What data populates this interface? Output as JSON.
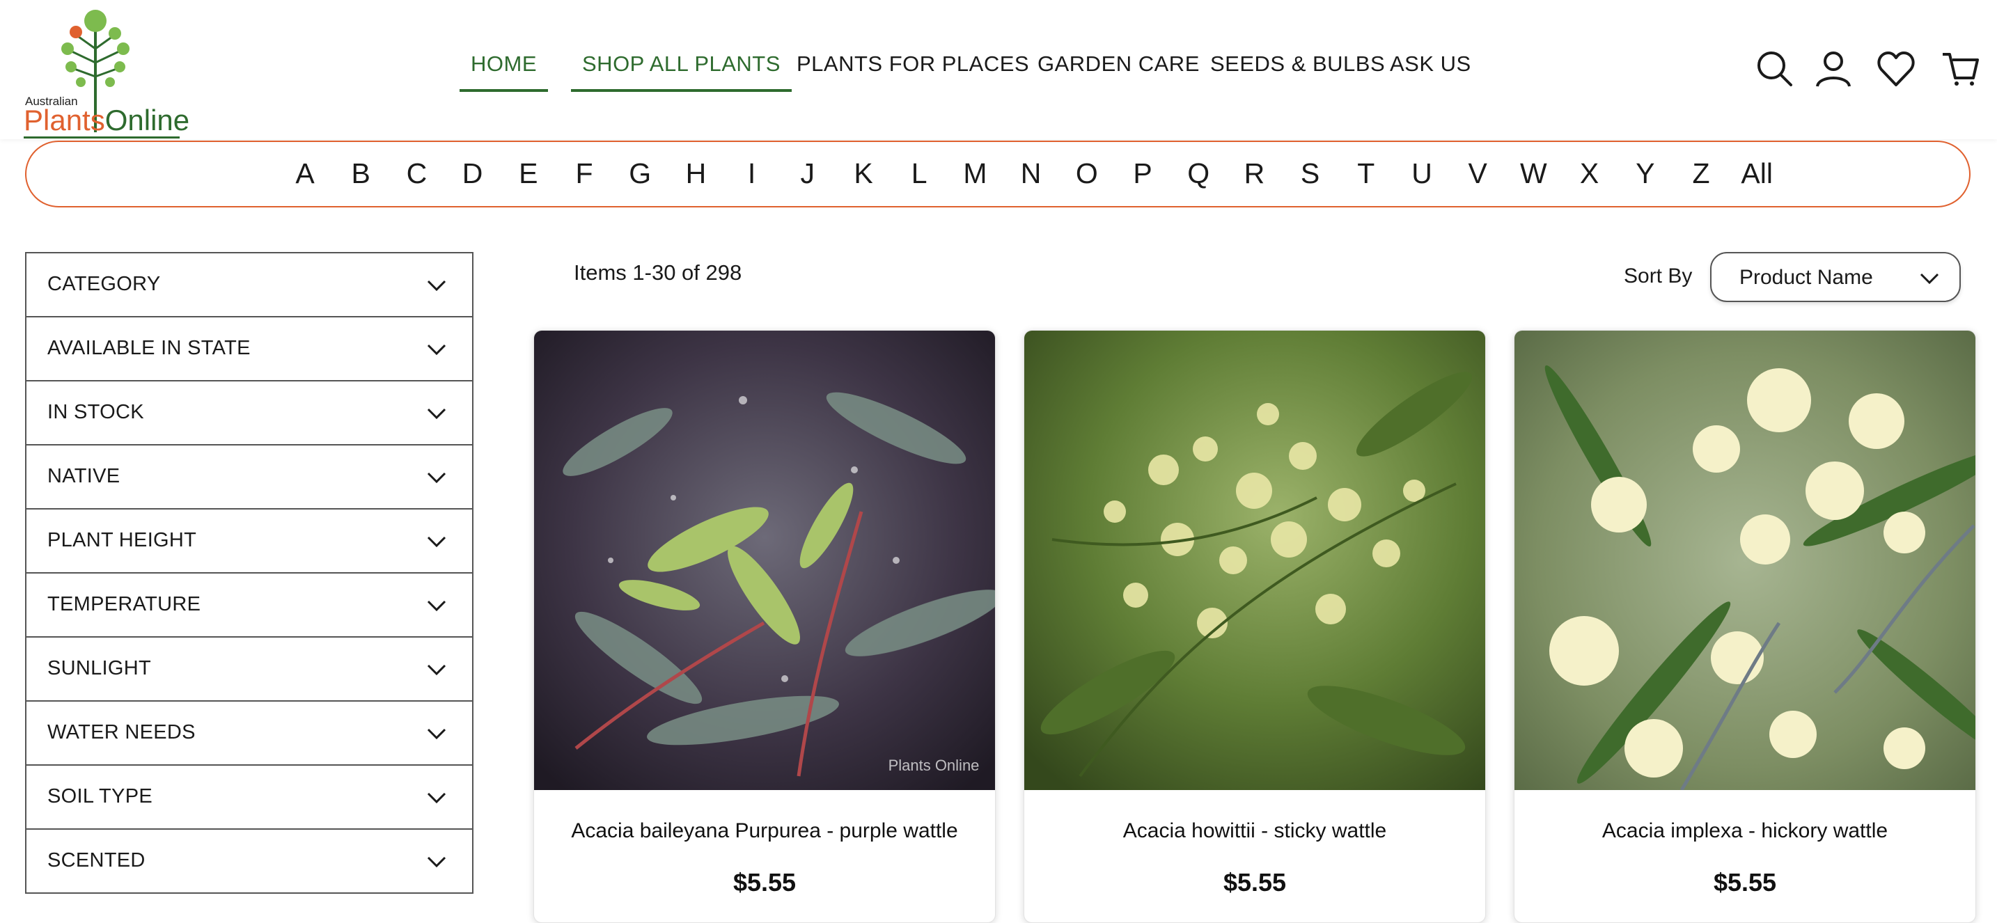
{
  "logo": {
    "small_text": "Australian",
    "word1": "Plants",
    "word2": "Online"
  },
  "nav": [
    {
      "label": "HOME",
      "active": true
    },
    {
      "label": "SHOP ALL PLANTS",
      "active": true
    },
    {
      "label": "PLANTS FOR PLACES",
      "active": false
    },
    {
      "label": "GARDEN CARE",
      "active": false
    },
    {
      "label": "SEEDS & BULBS",
      "active": false
    },
    {
      "label": "ASK US",
      "active": false
    }
  ],
  "header_icons": [
    "search-icon",
    "account-icon",
    "wishlist-heart-icon",
    "cart-icon"
  ],
  "alphabet": [
    "A",
    "B",
    "C",
    "D",
    "E",
    "F",
    "G",
    "H",
    "I",
    "J",
    "K",
    "L",
    "M",
    "N",
    "O",
    "P",
    "Q",
    "R",
    "S",
    "T",
    "U",
    "V",
    "W",
    "X",
    "Y",
    "Z",
    "All"
  ],
  "filters": [
    {
      "label": "CATEGORY"
    },
    {
      "label": "AVAILABLE IN STATE"
    },
    {
      "label": "IN STOCK"
    },
    {
      "label": "NATIVE"
    },
    {
      "label": "PLANT HEIGHT"
    },
    {
      "label": "TEMPERATURE"
    },
    {
      "label": "SUNLIGHT"
    },
    {
      "label": "WATER NEEDS"
    },
    {
      "label": "SOIL TYPE"
    },
    {
      "label": "SCENTED"
    }
  ],
  "toolbar": {
    "items_count": "Items 1-30 of 298",
    "sort_label": "Sort By",
    "sort_value": "Product Name"
  },
  "products": [
    {
      "name": "Acacia baileyana Purpurea - purple wattle",
      "price": "$5.55",
      "watermark": "Plants Online"
    },
    {
      "name": "Acacia howittii - sticky wattle",
      "price": "$5.55"
    },
    {
      "name": "Acacia implexa - hickory wattle",
      "price": "$5.55"
    }
  ],
  "colors": {
    "accent_orange": "#e0612f",
    "brand_green": "#2e6b2e"
  }
}
